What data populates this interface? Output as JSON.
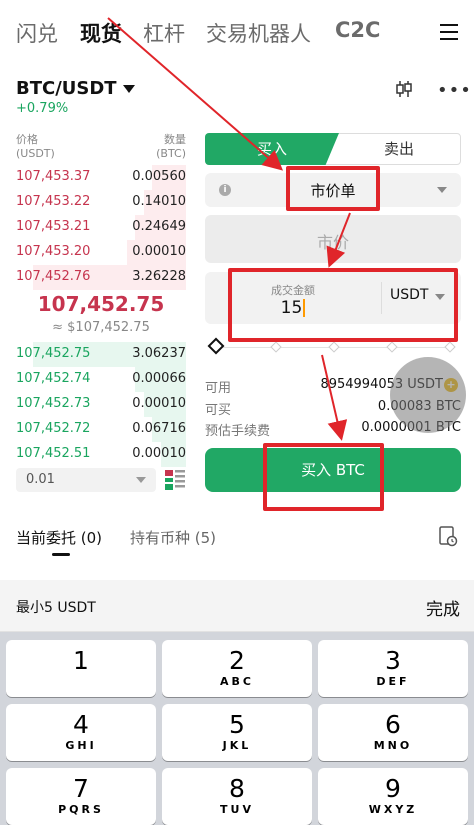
{
  "top_nav": {
    "tabs": [
      "闪兑",
      "现货",
      "杠杆",
      "交易机器人",
      "C2C"
    ],
    "active": "现货"
  },
  "pair": {
    "symbol": "BTC/USDT",
    "change": "+0.79%"
  },
  "order_book": {
    "price_header": "价格",
    "price_unit": "(USDT)",
    "qty_header": "数量",
    "qty_unit": "(BTC)",
    "asks": [
      {
        "price": "107,453.37",
        "qty": "0.00560",
        "depth": 0.2
      },
      {
        "price": "107,453.22",
        "qty": "0.14010",
        "depth": 0.25
      },
      {
        "price": "107,453.21",
        "qty": "0.24649",
        "depth": 0.3
      },
      {
        "price": "107,453.20",
        "qty": "0.00010",
        "depth": 0.35
      },
      {
        "price": "107,452.76",
        "qty": "3.26228",
        "depth": 0.9
      }
    ],
    "last_price": "107,452.75",
    "last_price_usd": "≈ $107,452.75",
    "bids": [
      {
        "price": "107,452.75",
        "qty": "3.06237",
        "depth": 0.9
      },
      {
        "price": "107,452.74",
        "qty": "0.00066",
        "depth": 0.3
      },
      {
        "price": "107,452.73",
        "qty": "0.00010",
        "depth": 0.25
      },
      {
        "price": "107,452.72",
        "qty": "0.06716",
        "depth": 0.2
      },
      {
        "price": "107,452.51",
        "qty": "0.00010",
        "depth": 0.15
      }
    ],
    "precision": "0.01"
  },
  "order_form": {
    "buy_tab": "买入",
    "sell_tab": "卖出",
    "order_type": "市价单",
    "price_placeholder": "市价",
    "amount_label": "成交金额",
    "amount_value": "15",
    "amount_unit": "USDT",
    "available_label": "可用",
    "available_value": "8954994053 USDT",
    "can_buy_label": "可买",
    "can_buy_value": "0.00083 BTC",
    "fee_label": "预估手续费",
    "fee_value": "0.0000001 BTC",
    "buy_button": "买入 BTC",
    "accent_color": "#21a865"
  },
  "orders_tabs": {
    "open": "当前委托 (0)",
    "holdings": "持有币种 (5)"
  },
  "keyboard": {
    "hint": "最小5 USDT",
    "done": "完成",
    "keys": [
      {
        "digit": "1",
        "letters": ""
      },
      {
        "digit": "2",
        "letters": "ABC"
      },
      {
        "digit": "3",
        "letters": "DEF"
      },
      {
        "digit": "4",
        "letters": "GHI"
      },
      {
        "digit": "5",
        "letters": "JKL"
      },
      {
        "digit": "6",
        "letters": "MNO"
      },
      {
        "digit": "7",
        "letters": "PQRS"
      },
      {
        "digit": "8",
        "letters": "TUV"
      },
      {
        "digit": "9",
        "letters": "WXYZ"
      }
    ]
  }
}
